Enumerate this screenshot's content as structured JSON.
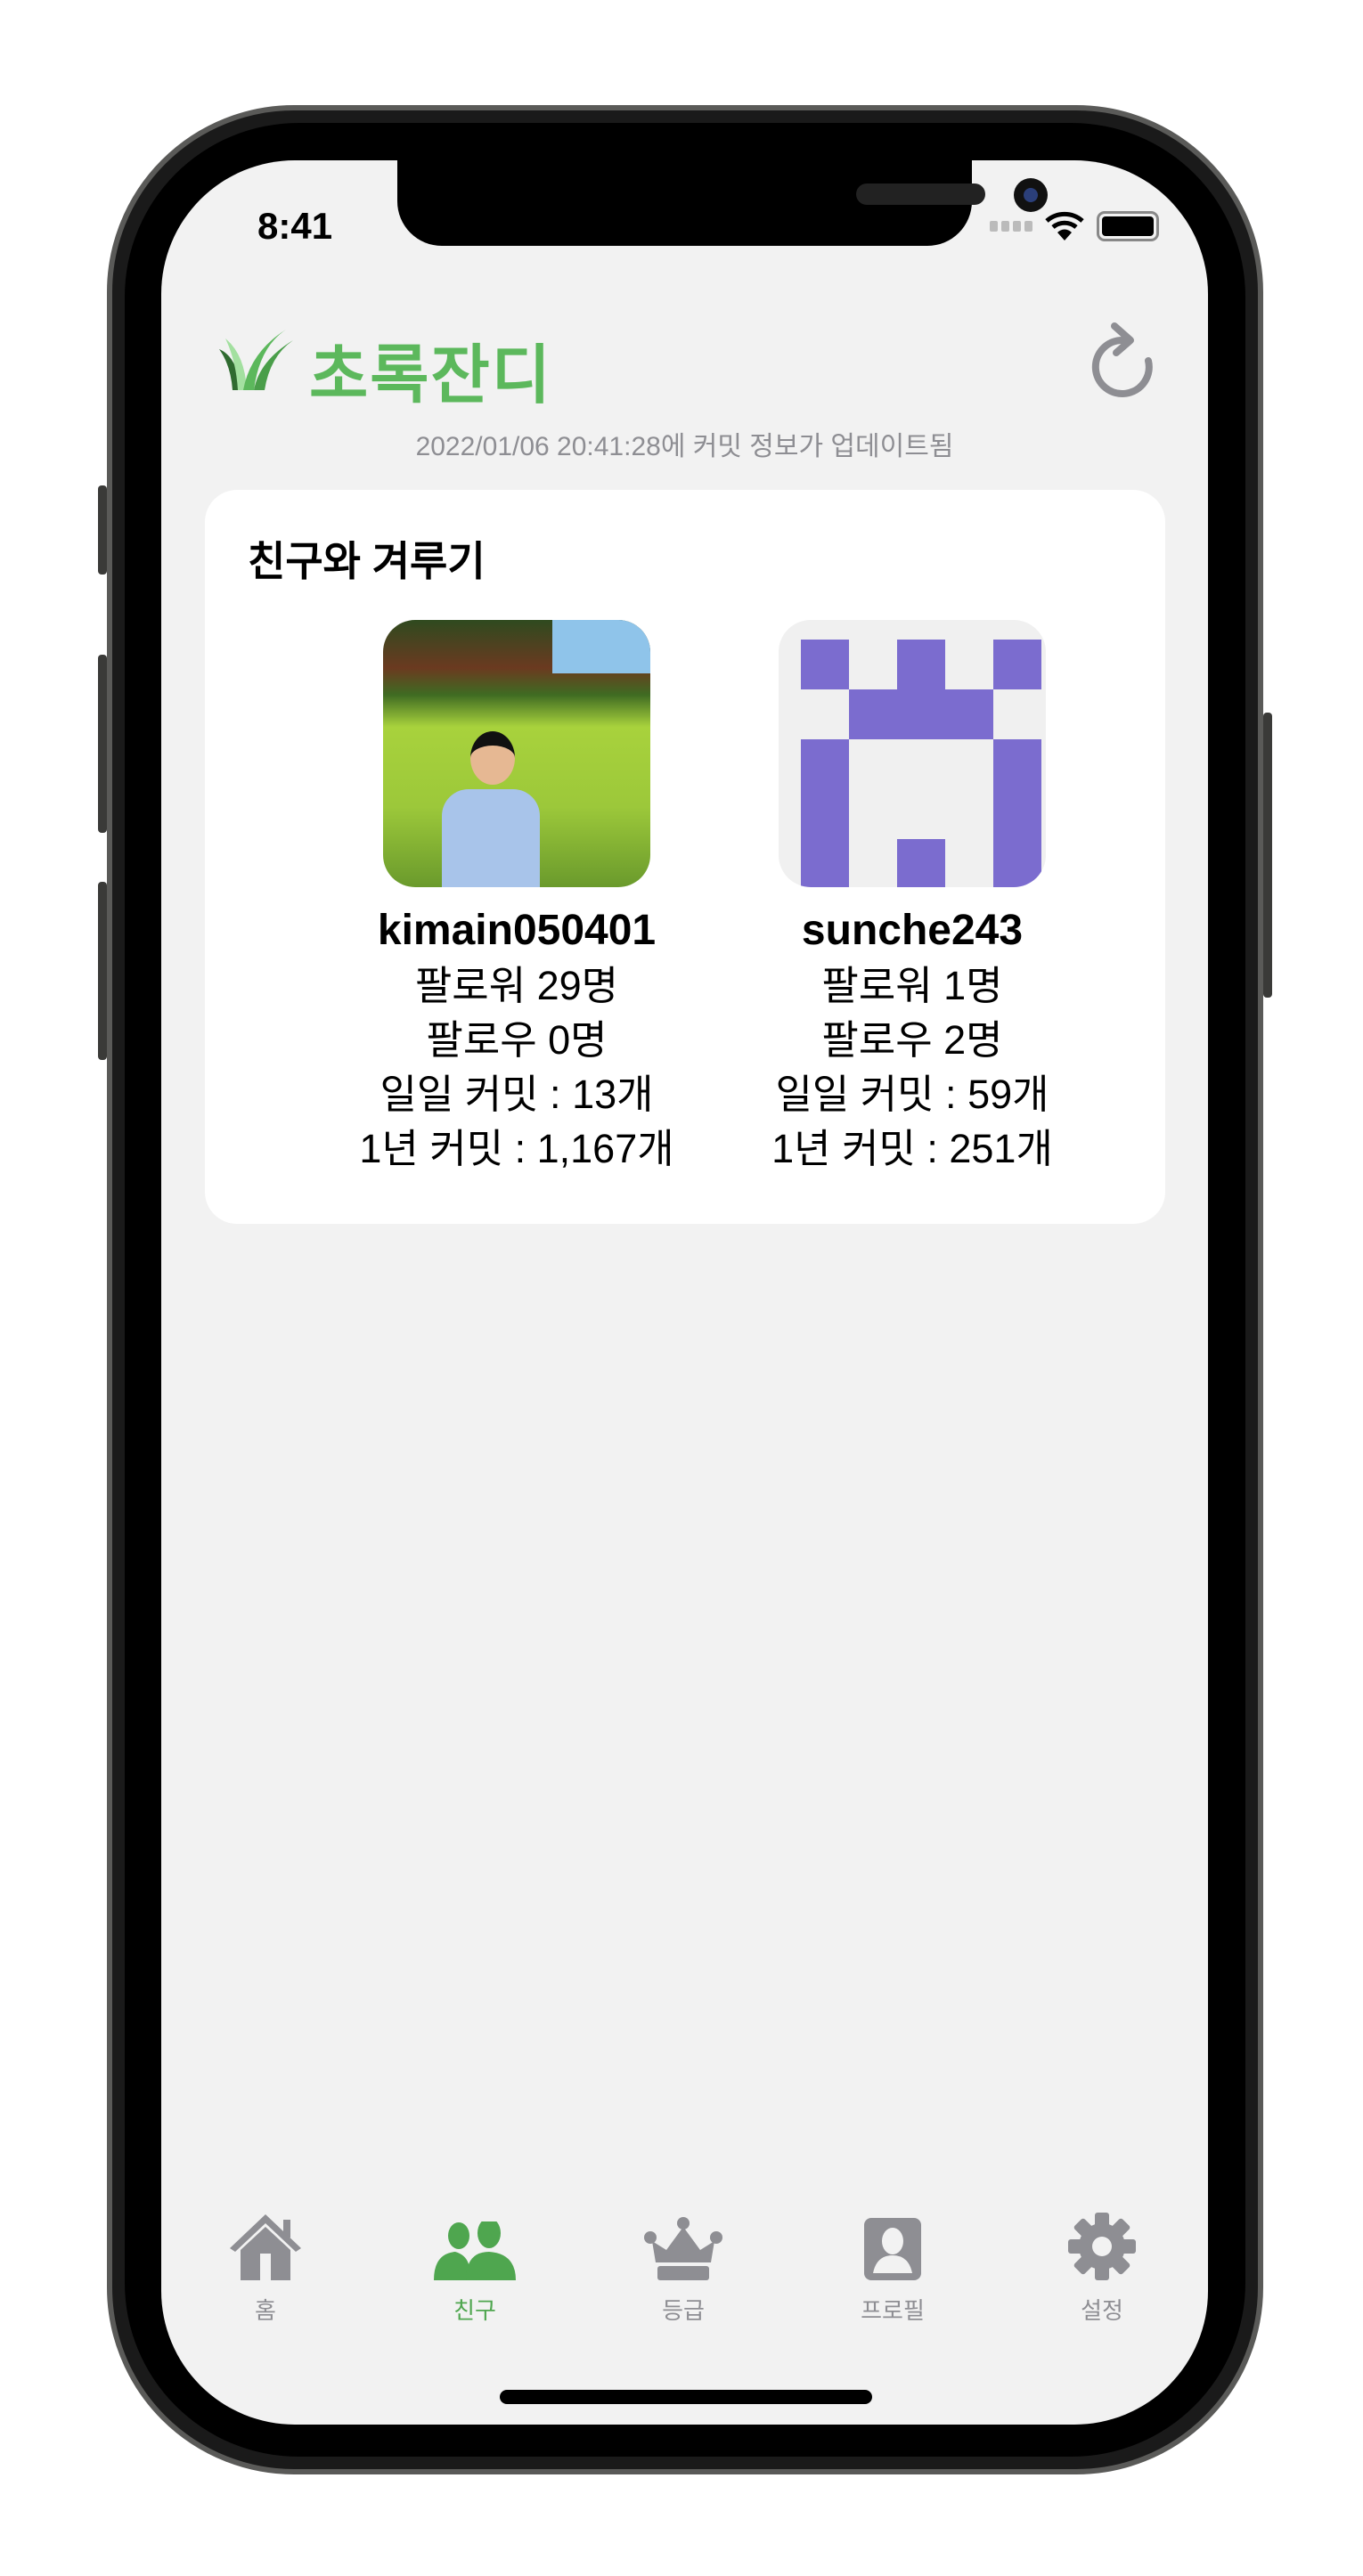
{
  "status_bar": {
    "time": "8:41"
  },
  "header": {
    "app_title": "초록잔디",
    "updated_text": "2022/01/06 20:41:28에 커밋 정보가 업데이트됨",
    "brand_color": "#5cb85c"
  },
  "card": {
    "title": "친구와 겨루기",
    "friends": [
      {
        "username": "kimain050401",
        "followers": "팔로워 29명",
        "following": "팔로우 0명",
        "daily_commits": "일일 커밋 : 13개",
        "yearly_commits": "1년 커밋 : 1,167개",
        "avatar": "photo"
      },
      {
        "username": "sunche243",
        "followers": "팔로워 1명",
        "following": "팔로우 2명",
        "daily_commits": "일일 커밋 : 59개",
        "yearly_commits": "1년 커밋 : 251개",
        "avatar": "identicon",
        "identicon_color": "#7b6ccf",
        "identicon_pattern": [
          [
            1,
            0,
            1,
            0,
            1
          ],
          [
            0,
            1,
            1,
            1,
            0
          ],
          [
            1,
            0,
            0,
            0,
            1
          ],
          [
            1,
            0,
            0,
            0,
            1
          ],
          [
            1,
            0,
            1,
            0,
            1
          ]
        ]
      }
    ]
  },
  "tabbar": {
    "active": 1,
    "items": [
      {
        "label": "홈",
        "icon": "home-icon"
      },
      {
        "label": "친구",
        "icon": "friends-icon"
      },
      {
        "label": "등급",
        "icon": "crown-icon"
      },
      {
        "label": "프로필",
        "icon": "profile-icon"
      },
      {
        "label": "설정",
        "icon": "gear-icon"
      }
    ]
  }
}
